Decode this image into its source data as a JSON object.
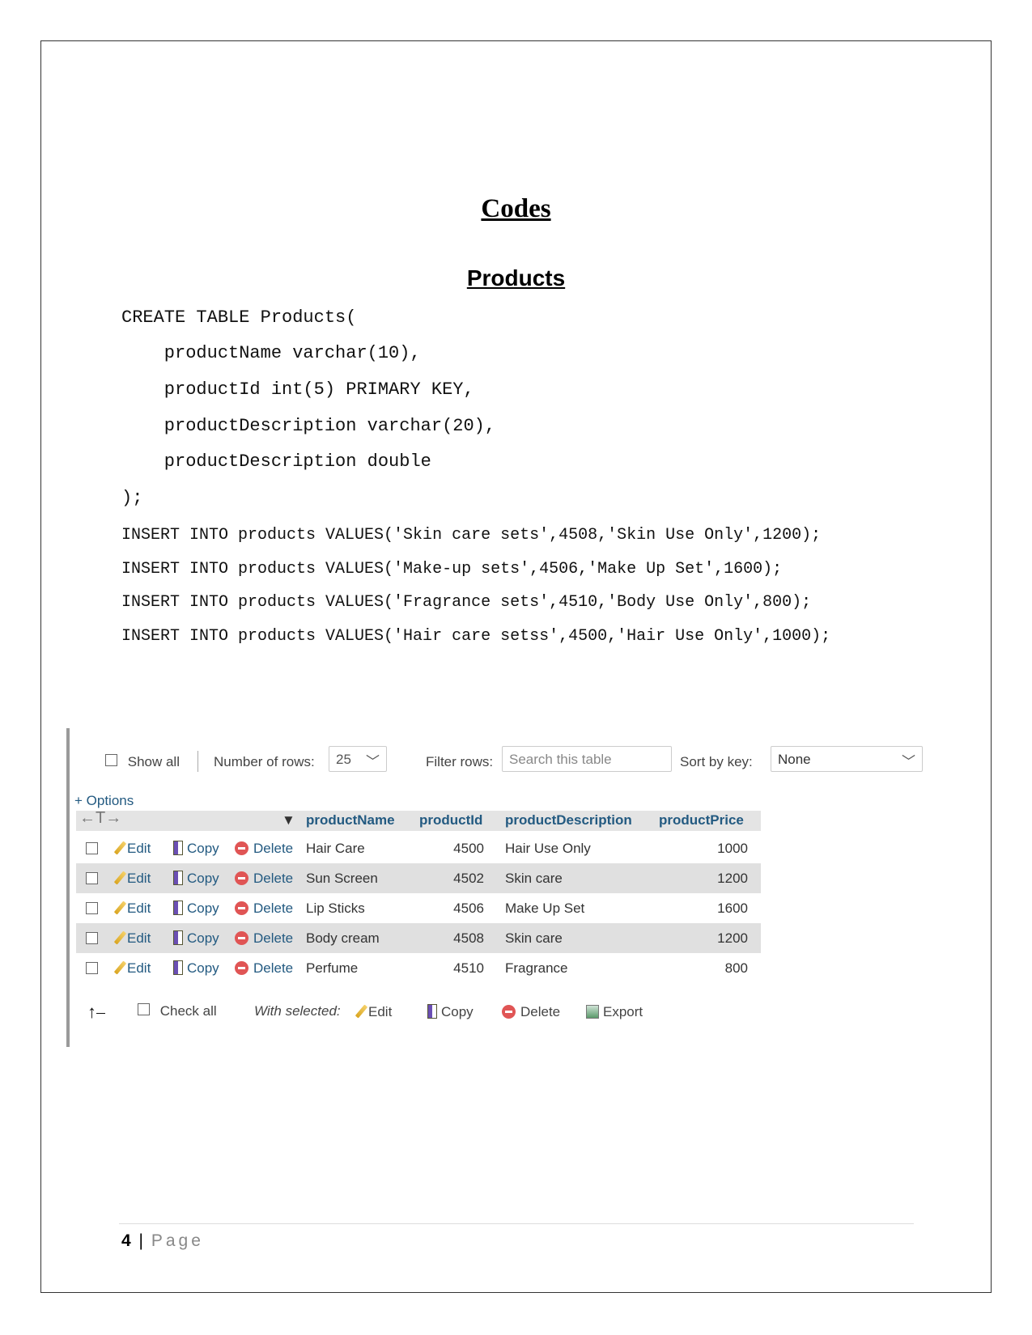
{
  "heading": "Codes",
  "subheading": "Products",
  "create_sql": [
    "CREATE TABLE Products(",
    "    productName varchar(10),",
    "    productId int(5) PRIMARY KEY,",
    "    productDescription varchar(20),",
    "    productDescription double",
    ");"
  ],
  "insert_sql": [
    "INSERT INTO products VALUES('Skin care sets',4508,'Skin Use Only',1200);",
    "INSERT INTO products VALUES('Make-up sets',4506,'Make Up Set',1600);",
    "INSERT INTO products VALUES('Fragrance sets',4510,'Body Use Only',800);",
    "INSERT INTO products VALUES('Hair care setss',4500,'Hair Use Only',1000);"
  ],
  "toolbar": {
    "show_all": "Show all",
    "rows_label": "Number of rows:",
    "rows_value": "25",
    "filter_label": "Filter rows:",
    "filter_placeholder": "Search this table",
    "sort_label": "Sort by key:",
    "sort_value": "None"
  },
  "options_label": "+ Options",
  "columns": [
    "productName",
    "productId",
    "productDescription",
    "productPrice"
  ],
  "actions": {
    "edit": "Edit",
    "copy": "Copy",
    "delete": "Delete",
    "export": "Export"
  },
  "rows": [
    {
      "name": "Hair Care",
      "id": "4500",
      "desc": "Hair Use Only",
      "price": "1000"
    },
    {
      "name": "Sun Screen",
      "id": "4502",
      "desc": "Skin care",
      "price": "1200"
    },
    {
      "name": "Lip Sticks",
      "id": "4506",
      "desc": "Make Up Set",
      "price": "1600"
    },
    {
      "name": "Body cream",
      "id": "4508",
      "desc": "Skin care",
      "price": "1200"
    },
    {
      "name": "Perfume",
      "id": "4510",
      "desc": "Fragrance",
      "price": "800"
    }
  ],
  "bulk": {
    "check_all": "Check all",
    "with_selected": "With selected:"
  },
  "footer": {
    "page_number": "4",
    "page_label": "Page"
  }
}
